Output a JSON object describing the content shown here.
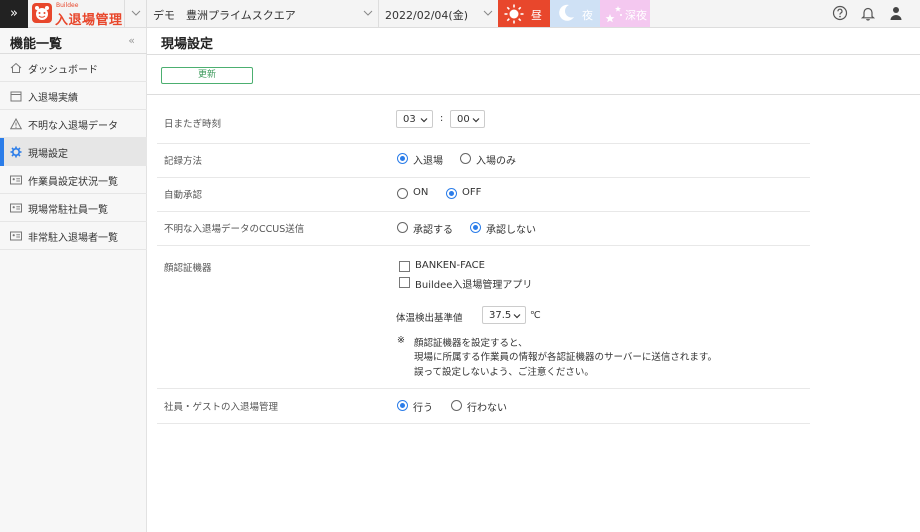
{
  "topbar": {
    "expand_icon": "»",
    "logo_small": "Buildee",
    "logo_main": "入退場管理",
    "site_name": "デモ　豊洲プライムスクエア",
    "date": "2022/02/04(金)",
    "time_day": "昼",
    "time_night": "夜",
    "time_late": "深夜",
    "colors": {
      "day": "#e8472c",
      "night": "#cfe1f5",
      "late": "#f4c8f0"
    }
  },
  "sidebar": {
    "title": "機能一覧",
    "collapse_icon": "«",
    "items": [
      {
        "label": "ダッシュボード",
        "icon": "home-icon"
      },
      {
        "label": "入退場実績",
        "icon": "calendar-icon"
      },
      {
        "label": "不明な入退場データ",
        "icon": "warning-icon"
      },
      {
        "label": "現場設定",
        "icon": "gear-icon",
        "active": true
      },
      {
        "label": "作業員設定状況一覧",
        "icon": "id-card-icon"
      },
      {
        "label": "現場常駐社員一覧",
        "icon": "id-card-icon"
      },
      {
        "label": "非常駐入退場者一覧",
        "icon": "id-card-icon"
      }
    ]
  },
  "main": {
    "title": "現場設定",
    "update_button": "更新",
    "settings": {
      "cutoff": {
        "label": "日またぎ時刻",
        "hour": "03",
        "minute": "00",
        "separator": ":"
      },
      "record": {
        "label": "記録方法",
        "options": [
          "入退場",
          "入場のみ"
        ],
        "selected": 0
      },
      "auto_approve": {
        "label": "自動承認",
        "options": [
          "ON",
          "OFF"
        ],
        "selected": 1
      },
      "ccus": {
        "label": "不明な入退場データのCCUS送信",
        "options": [
          "承認する",
          "承認しない"
        ],
        "selected": 1
      },
      "face": {
        "label": "顔認証機器",
        "devices": [
          "BANKEN-FACE",
          "Buildee入退場管理アプリ"
        ],
        "temp_label": "体温検出基準値",
        "temp_value": "37.5",
        "temp_unit": "℃",
        "note_mark": "※",
        "note_lines": [
          "顔認証機器を設定すると、",
          "現場に所属する作業員の情報が各認証機器のサーバーに送信されます。",
          "誤って設定しないよう、ご注意ください。"
        ]
      },
      "guest": {
        "label": "社員・ゲストの入退場管理",
        "options": [
          "行う",
          "行わない"
        ],
        "selected": 0
      }
    }
  }
}
